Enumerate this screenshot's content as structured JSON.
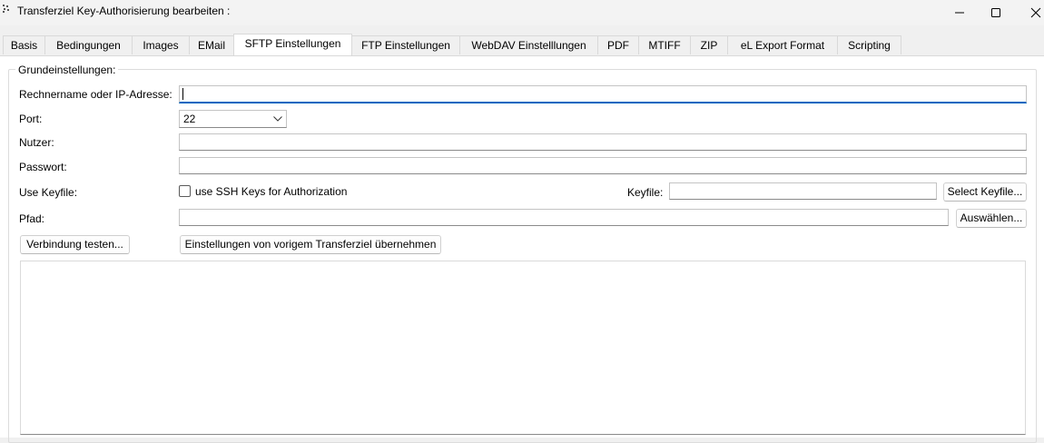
{
  "window": {
    "title": "Transferziel Key-Authorisierung bearbeiten :",
    "controls": [
      "minimize-icon",
      "maximize-icon",
      "close-icon"
    ]
  },
  "tabs": [
    {
      "label": "Basis",
      "active": false
    },
    {
      "label": "Bedingungen",
      "active": false
    },
    {
      "label": "Images",
      "active": false
    },
    {
      "label": "EMail",
      "active": false
    },
    {
      "label": "SFTP Einstellungen",
      "active": true
    },
    {
      "label": "FTP Einstellungen",
      "active": false
    },
    {
      "label": "WebDAV Einstelllungen",
      "active": false
    },
    {
      "label": "PDF",
      "active": false
    },
    {
      "label": "MTIFF",
      "active": false
    },
    {
      "label": "ZIP",
      "active": false
    },
    {
      "label": "eL Export Format",
      "active": false
    },
    {
      "label": "Scripting",
      "active": false
    }
  ],
  "group": {
    "label": "Grundeinstellungen:"
  },
  "form": {
    "host_label": "Rechnername oder IP-Adresse:",
    "host_value": "",
    "port_label": "Port:",
    "port_value": "22",
    "user_label": "Nutzer:",
    "user_value": "",
    "password_label": "Passwort:",
    "password_value": "",
    "keyfile_row_label": "Use Keyfile:",
    "ssh_checkbox_label": "use SSH Keys for Authorization",
    "ssh_checked": false,
    "keyfile_label": "Keyfile:",
    "keyfile_value": "",
    "select_keyfile_button": "Select Keyfile...",
    "path_label": "Pfad:",
    "path_value": "",
    "browse_button": "Auswählen..."
  },
  "actions": {
    "test_connection": "Verbindung testen...",
    "copy_settings": "Einstellungen von vorigem Transferziel übernehmen"
  },
  "log": {
    "text": ""
  },
  "colors": {
    "accent": "#0067c0",
    "window_bg": "#f0f0f0",
    "panel_bg": "#ffffff"
  }
}
